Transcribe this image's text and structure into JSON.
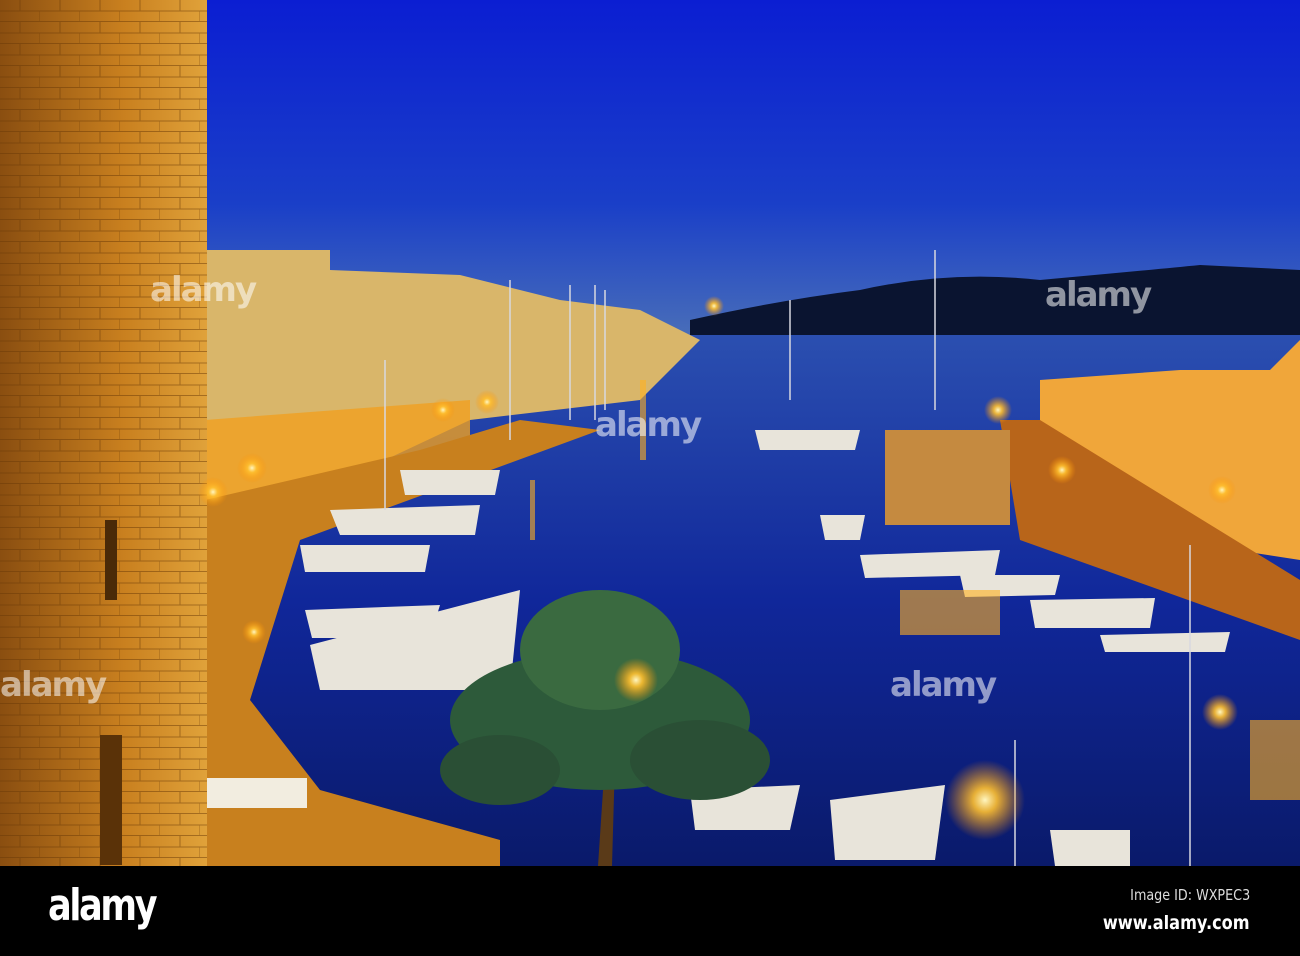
{
  "scene": {
    "subject": "harbor at dusk",
    "colors": {
      "sky_top": "#0a1fd0",
      "sky_horizon": "#3b62b8",
      "water": "#0d1f7a",
      "light": "#ffb21f",
      "wall": "#b8731c"
    }
  },
  "watermark": {
    "text": "alamy"
  },
  "footer": {
    "logo": "alamy",
    "image_id": "Image ID: WXPEC3",
    "site": "www.alamy.com"
  }
}
